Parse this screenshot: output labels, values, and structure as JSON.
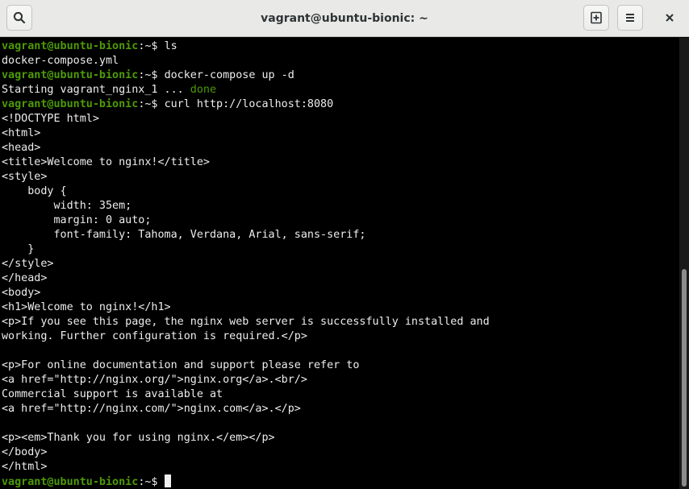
{
  "window": {
    "title": "vagrant@ubuntu-bionic: ~"
  },
  "titlebar": {
    "search_icon": "search-icon",
    "new_tab_icon": "new-tab-icon",
    "menu_icon": "hamburger-menu-icon",
    "close_icon": "close-icon"
  },
  "colors": {
    "titlebar_bg": "#e9e9e7",
    "terminal_bg": "#000000",
    "text": "#ededed",
    "prompt_green": "#4e9a06"
  },
  "terminal": {
    "prompt_user": "vagrant@ubuntu-bionic",
    "prompt_sep": ":~$ ",
    "lines": [
      {
        "type": "prompt",
        "cmd": "ls"
      },
      {
        "type": "out",
        "text": "docker-compose.yml"
      },
      {
        "type": "prompt",
        "cmd": "docker-compose up -d"
      },
      {
        "type": "status",
        "text": "Starting vagrant_nginx_1 ... ",
        "status": "done"
      },
      {
        "type": "prompt",
        "cmd": "curl http://localhost:8080"
      },
      {
        "type": "out",
        "text": "<!DOCTYPE html>"
      },
      {
        "type": "out",
        "text": "<html>"
      },
      {
        "type": "out",
        "text": "<head>"
      },
      {
        "type": "out",
        "text": "<title>Welcome to nginx!</title>"
      },
      {
        "type": "out",
        "text": "<style>"
      },
      {
        "type": "out",
        "text": "    body {"
      },
      {
        "type": "out",
        "text": "        width: 35em;"
      },
      {
        "type": "out",
        "text": "        margin: 0 auto;"
      },
      {
        "type": "out",
        "text": "        font-family: Tahoma, Verdana, Arial, sans-serif;"
      },
      {
        "type": "out",
        "text": "    }"
      },
      {
        "type": "out",
        "text": "</style>"
      },
      {
        "type": "out",
        "text": "</head>"
      },
      {
        "type": "out",
        "text": "<body>"
      },
      {
        "type": "out",
        "text": "<h1>Welcome to nginx!</h1>"
      },
      {
        "type": "out",
        "text": "<p>If you see this page, the nginx web server is successfully installed and"
      },
      {
        "type": "out",
        "text": "working. Further configuration is required.</p>"
      },
      {
        "type": "out",
        "text": ""
      },
      {
        "type": "out",
        "text": "<p>For online documentation and support please refer to"
      },
      {
        "type": "out",
        "text": "<a href=\"http://nginx.org/\">nginx.org</a>.<br/>"
      },
      {
        "type": "out",
        "text": "Commercial support is available at"
      },
      {
        "type": "out",
        "text": "<a href=\"http://nginx.com/\">nginx.com</a>.</p>"
      },
      {
        "type": "out",
        "text": ""
      },
      {
        "type": "out",
        "text": "<p><em>Thank you for using nginx.</em></p>"
      },
      {
        "type": "out",
        "text": "</body>"
      },
      {
        "type": "out",
        "text": "</html>"
      },
      {
        "type": "prompt",
        "cmd": "",
        "cursor": true
      }
    ]
  }
}
